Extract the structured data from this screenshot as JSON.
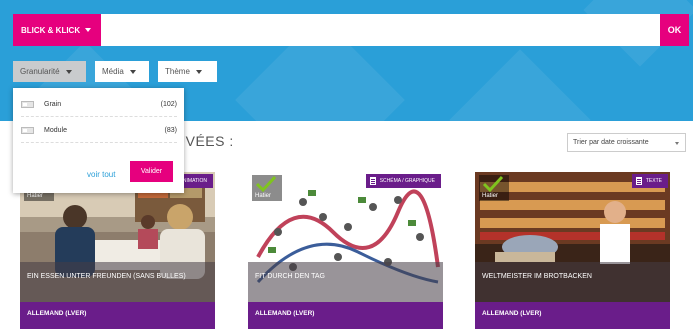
{
  "search": {
    "mode_label": "BLICK & KLICK",
    "value": "",
    "ok_label": "OK"
  },
  "filters": [
    {
      "label": "Granularité",
      "active": true
    },
    {
      "label": "Média",
      "active": false
    },
    {
      "label": "Thème",
      "active": false
    }
  ],
  "granularity_dropdown": {
    "options": [
      {
        "label": "Grain",
        "count": "(102)"
      },
      {
        "label": "Module",
        "count": "(83)"
      }
    ],
    "show_all_label": "voir tout",
    "validate_label": "Valider"
  },
  "results": {
    "heading": "UVÉES :",
    "sort_value": "Trier par date croissante"
  },
  "cards": [
    {
      "title": "EIN ESSEN UNTER FREUNDEN (SANS BULLES)",
      "subject": "ALLEMAND (LVER)",
      "type": "ANIMATION",
      "publisher": "Hatier"
    },
    {
      "title": "FIT DURCH DEN TAG",
      "subject": "ALLEMAND (LVER)",
      "type": "SCHÉMA / GRAPHIQUE",
      "publisher": "Hatier"
    },
    {
      "title": "WELTMEISTER IM BROTBACKEN",
      "subject": "ALLEMAND (LVER)",
      "type": "TEXTE",
      "publisher": "Hatier"
    }
  ],
  "colors": {
    "header_blue": "#2a9fd8",
    "accent_pink": "#e6007e",
    "card_purple": "#6a1d8a"
  }
}
